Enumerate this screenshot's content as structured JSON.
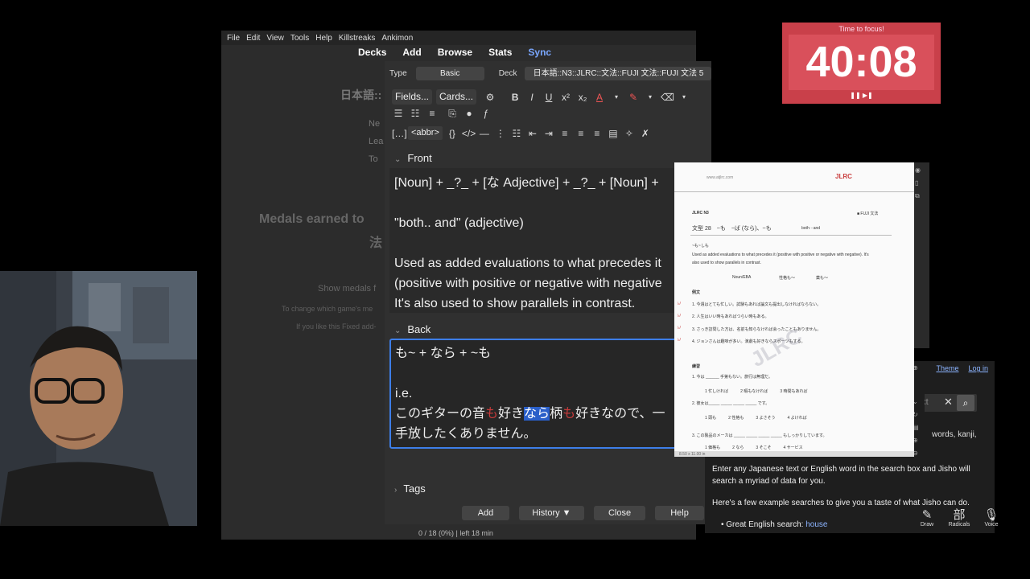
{
  "anki": {
    "menu": [
      "File",
      "Edit",
      "View",
      "Tools",
      "Help",
      "Killstreaks",
      "Ankimon"
    ],
    "toolbar": [
      "Decks",
      "Add",
      "Browse",
      "Stats",
      "Sync"
    ],
    "bg_deck_title": "日本語::",
    "bg_side_labels": [
      "Ne",
      "Lea",
      "To"
    ],
    "bg_medals_line1": "Medals earned to",
    "bg_medals_line2": "法",
    "bg_show_medals": "Show medals f",
    "bg_change": "To change which game's me",
    "bg_like": "If you like this Fixed add-",
    "status": "0 / 18 (0%) | left 18 min"
  },
  "add_dialog": {
    "type_label": "Type",
    "type_value": "Basic",
    "deck_label": "Deck",
    "deck_value": "日本語::N3::JLRC::文法::FUJI 文法::FUJI 文法 5",
    "fields_btn": "Fields...",
    "cards_btn": "Cards...",
    "abbr_btn": "<abbr>",
    "front_label": "Front",
    "back_label": "Back",
    "front_lines": [
      "[Noun] + _?_ + [な Adjective] + _?_ + [Noun] +",
      "",
      "\"both.. and\" (adjective)",
      "",
      "Used as added evaluations to what precedes it",
      "(positive with positive or negative with negative",
      "It's also used to show parallels in contrast."
    ],
    "back_line1": "も~ + なら + ~も",
    "back_line3": "i.e.",
    "back_s1": "このギターの音",
    "back_s2": "も",
    "back_s3": "好き",
    "back_s4": "なら",
    "back_s5": "柄",
    "back_s6": "も",
    "back_s7": "好きなので、一",
    "back_line5": "手放したくありません。",
    "tags_label": "Tags",
    "buttons": [
      "Add",
      "History ▼",
      "Close",
      "Help"
    ]
  },
  "timer": {
    "title": "Time to focus!",
    "time": "40:08",
    "controls": "❚❚ ▶❚"
  },
  "jisho": {
    "theme": "Theme",
    "login": "Log in",
    "search_placeholder": "ext",
    "words_snippet": "words, kanji,",
    "para1a": "Enter any Japanese text or English word in the search box and Jisho will",
    "para1b": "search a myriad of data for you.",
    "para2": "Here's a few example searches to give you a taste of what Jisho can do.",
    "li_prefix": "Great English search: ",
    "li_link": "house",
    "tools": [
      {
        "icon": "draw-icon",
        "glyph": "✎",
        "label": "Draw"
      },
      {
        "icon": "radicals-icon",
        "glyph": "部",
        "label": "Radicals"
      },
      {
        "icon": "voice-icon",
        "glyph": "🎙",
        "label": "Voice"
      }
    ]
  },
  "pdf": {
    "top_left": "www.atjlrc.com",
    "top_logo": "JLRC",
    "header_left": "JLRC N3",
    "header_right": "■ FUJI 文法",
    "title": "文型 28　~も　~ば (なら)、~も",
    "title_right": "both···and",
    "pattern": "~も~しも",
    "desc1": "Used as added evaluations to what precedes it (positive with positive or negative with negative). It's",
    "desc2": "also used to show parallels in contrast.",
    "table_a": "Noun/EBA",
    "table_b": "性格も～",
    "table_c": "薬も～",
    "ex_head": "例文",
    "ex1": "1. 今週はとても忙しい。試験もあれば論文も提出しなければならない。",
    "ex2": "2. 人生はいい時もあればつらい時もある。",
    "ex3": "3. さっき訪問した方は、名前も知らなければ会ったこともありません。",
    "ex4": "4. ジョンさんは趣味が多い。演劇も好きならスポーツもする。",
    "pr_head": "練習",
    "pr1": "1. 今は ______ 手第もない。旅行は無理だ。",
    "pr1o": "1 忙しければ　　　2 暇もなければ　　　3 時間もあれば",
    "pr2": "2. 彼女は_____ _____ _____ _____ です。",
    "pr2o": "1 頭も　　　2 性格も　　　3 よさそう　　　4 よければ",
    "pr3": "3. この製品のメーカは _____ _____ _____ _____ もしっかりしています。",
    "pr3o": "1 価格も　　　2 なら　　　3 そこそ　　　4 サービス",
    "watermark": "JLRC",
    "foot": "8.50 x 11.00 in"
  },
  "colors": {
    "accent_blue": "#3d7ee8",
    "timer_red": "#c9404a",
    "highlight_red": "#c83b3b"
  }
}
